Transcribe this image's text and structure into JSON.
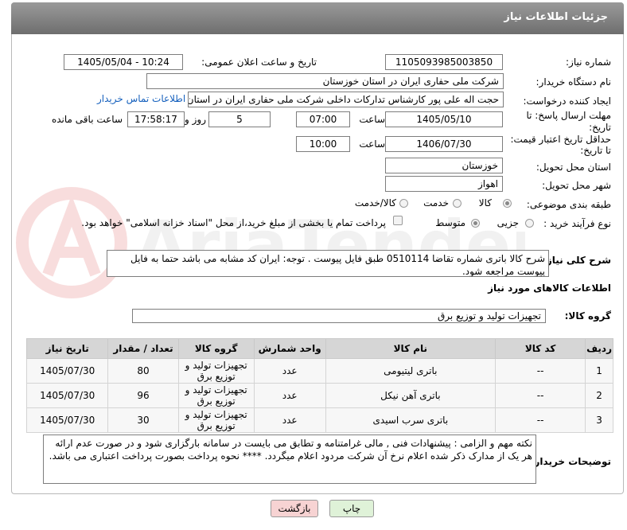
{
  "header": {
    "title": "جزئیات اطلاعات نیاز"
  },
  "fields": {
    "need_number_label": "شماره نیاز:",
    "need_number": "1105093985003850",
    "announce_label": "تاریخ و ساعت اعلان عمومی:",
    "announce_value": "1405/05/04 - 10:24",
    "buyer_org_label": "نام دستگاه خریدار:",
    "buyer_org": "شرکت ملی حفاری ایران در استان خوزستان",
    "requester_label": "ایجاد کننده درخواست:",
    "requester": "حجت اله علی پور کارشناس تدارکات داخلی شرکت ملی حفاری ایران در استان",
    "contact_link": "اطلاعات تماس خریدار",
    "deadline_label_1": "مهلت ارسال پاسخ: تا",
    "deadline_label_2": "تاریخ:",
    "deadline_date": "1405/05/10",
    "hour_label": "ساعت",
    "deadline_time": "07:00",
    "days_value": "5",
    "days_label": "روز و",
    "remaining_time": "17:58:17",
    "remaining_label": "ساعت باقی مانده",
    "min_valid_label_1": "حداقل تاریخ اعتبار قیمت:",
    "min_valid_label_2": "تا تاریخ:",
    "valid_date": "1406/07/30",
    "valid_hour_label": "ساعت",
    "valid_time": "10:00",
    "province_label": "استان محل تحویل:",
    "province": "خوزستان",
    "city_label": "شهر محل تحویل:",
    "city": "اهواز",
    "category_label": "طبقه بندی موضوعی:",
    "category_options": [
      "کالا",
      "خدمت",
      "کالا/خدمت"
    ],
    "category_selected": "کالا",
    "process_label": "نوع فرآیند خرید :",
    "process_options": [
      "جزیی",
      "متوسط"
    ],
    "process_selected": "متوسط",
    "payment_note": "پرداخت تمام یا بخشی از مبلغ خرید،از محل \"اسناد خزانه اسلامی\" خواهد بود."
  },
  "description": {
    "label": "شرح کلی نیاز:",
    "text": "شرح کالا باتری شماره تقاضا 0510114 طبق فایل پیوست . توجه: ایران کد مشابه می باشد حتما به فایل پیوست مراجعه شود."
  },
  "goods_info_title": "اطلاعات کالاهای مورد نیاز",
  "goods_group": {
    "label": "گروه کالا:",
    "value": "تجهیزات تولید و توزیع برق"
  },
  "table": {
    "headers": [
      "ردیف",
      "کد کالا",
      "نام کالا",
      "واحد شمارش",
      "گروه کالا",
      "تعداد / مقدار",
      "تاریخ نیاز"
    ],
    "rows": [
      [
        "1",
        "--",
        "باتری لیتیومی",
        "عدد",
        "تجهیزات تولید و توزیع برق",
        "80",
        "1405/07/30"
      ],
      [
        "2",
        "--",
        "باتری آهن نیکل",
        "عدد",
        "تجهیزات تولید و توزیع برق",
        "96",
        "1405/07/30"
      ],
      [
        "3",
        "--",
        "باتری سرب اسیدی",
        "عدد",
        "تجهیزات تولید و توزیع برق",
        "30",
        "1405/07/30"
      ]
    ]
  },
  "buyer_notes": {
    "label": "توضیحات خریدار:",
    "text": "نکته مهم و الزامی : پیشنهادات فنی , مالی غرامتنامه و تطابق می بایست در سامانه بارگزاری شود و در صورت عدم ارائه هر یک از مدارک ذکر شده اعلام نرخ آن شرکت مردود اعلام میگردد.   ****     نحوه پرداخت بصورت پرداخت اعتباری می باشد."
  },
  "buttons": {
    "print": "چاپ",
    "back": "بازگشت"
  },
  "colors": {
    "header": "#7d7d7d",
    "link": "#1560bd",
    "back_button": "#f7d3d3",
    "print_button": "#dff2d8"
  }
}
